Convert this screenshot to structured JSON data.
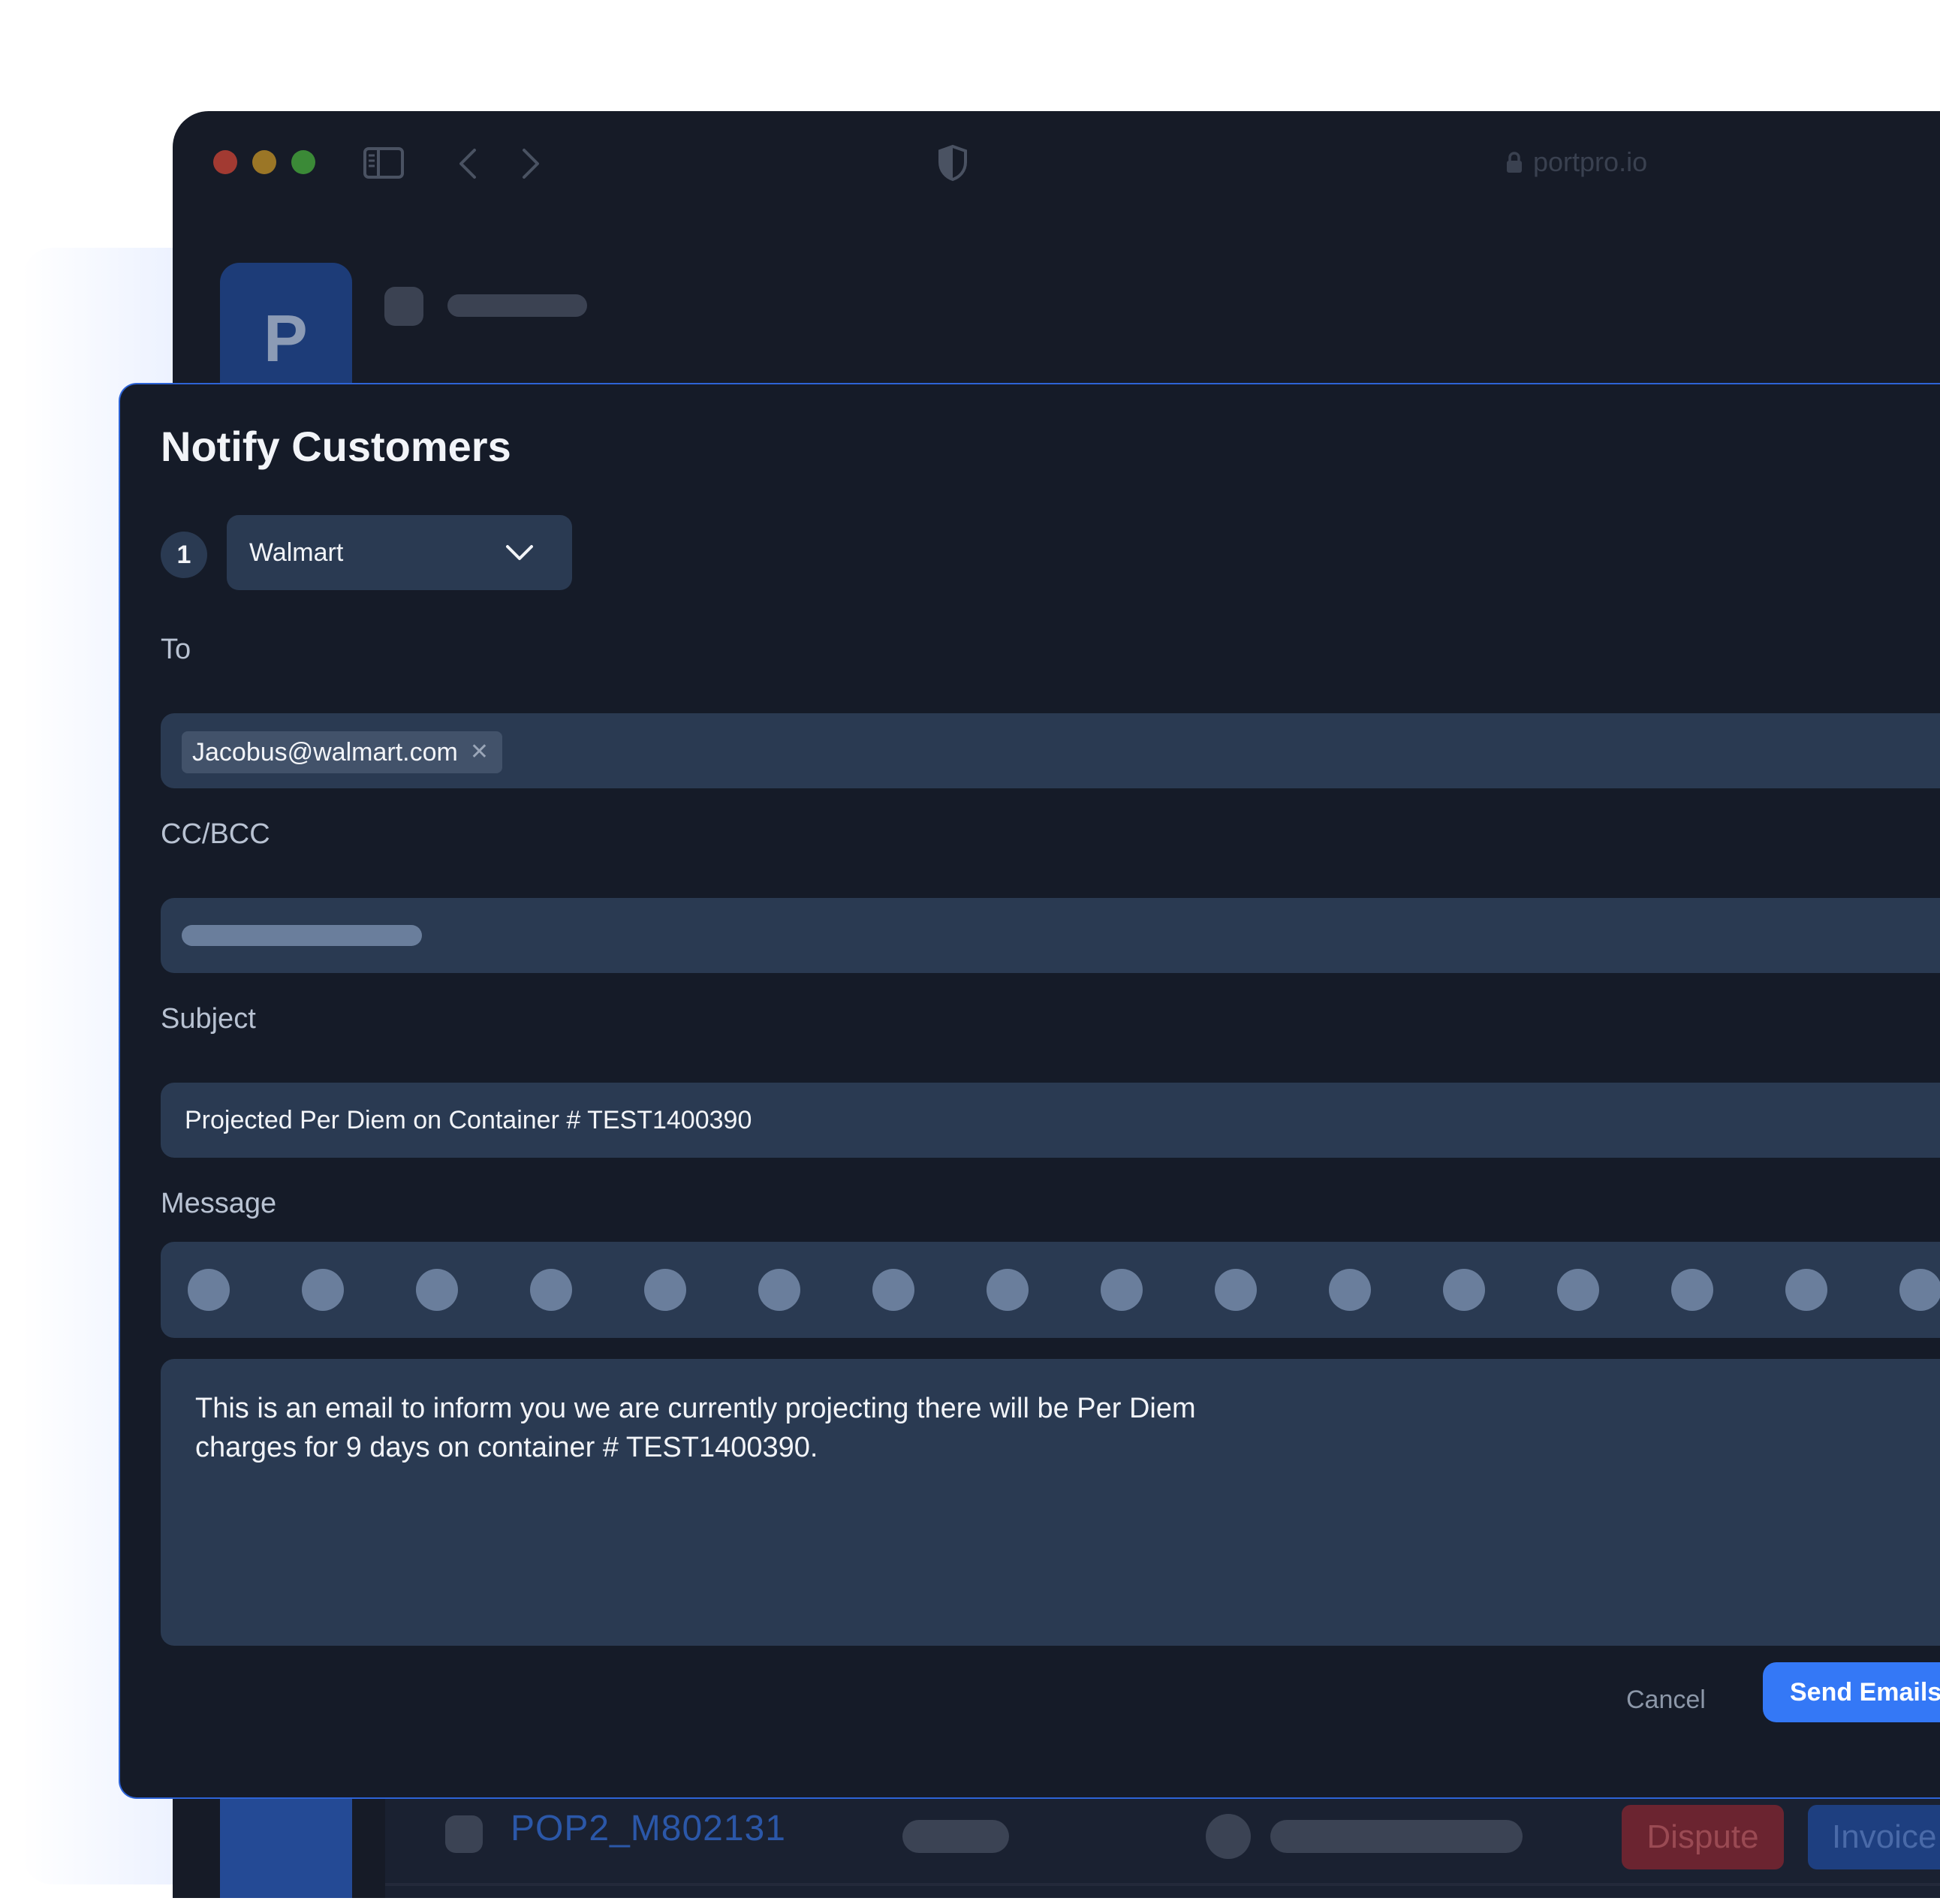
{
  "browser": {
    "url": "portpro.io",
    "logo_letter": "P"
  },
  "background_row": {
    "id": "POP2_M802131",
    "dispute_label": "Dispute",
    "invoice_label": "Invoice"
  },
  "modal": {
    "title": "Notify Customers",
    "step_number": "1",
    "customer": "Walmart",
    "to_label": "To",
    "to_recipients": [
      "Jacobus@walmart.com"
    ],
    "cc_label": "CC/BCC",
    "subject_label": "Subject",
    "subject_value": "Projected Per Diem on Container # TEST1400390",
    "message_label": "Message",
    "message_line1": "This is an email to inform you we are currently projecting there will be Per Diem",
    "message_line2": "charges for 9 days on container # TEST1400390.",
    "cancel_label": "Cancel",
    "send_label": "Send Emails"
  },
  "colors": {
    "accent": "#3478f6",
    "modal_border": "#2d63d6",
    "dispute": "#6b2430",
    "invoice": "#1e3f80"
  }
}
